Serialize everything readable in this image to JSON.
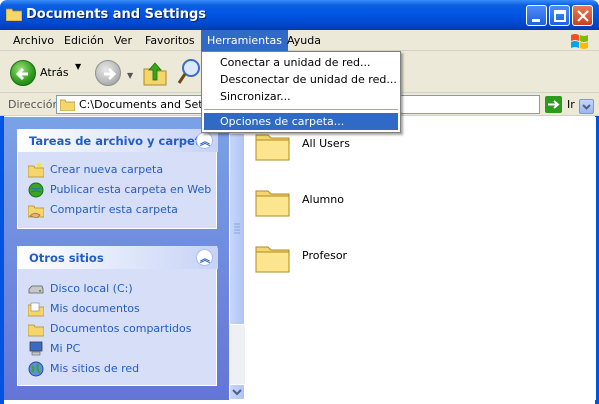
{
  "window": {
    "title": "Documents and Settings"
  },
  "menubar": {
    "items": [
      "Archivo",
      "Edición",
      "Ver",
      "Favoritos",
      "Herramientas",
      "Ayuda"
    ],
    "active": "Herramientas"
  },
  "toolbar": {
    "back_label": "Atrás"
  },
  "address": {
    "label": "Dirección",
    "value": "C:\\Documents and Settin",
    "go_label": "Ir"
  },
  "dropdown": {
    "items": [
      "Conectar a unidad de red...",
      "Desconectar de unidad de red...",
      "Sincronizar...",
      "Opciones de carpeta..."
    ],
    "selected": "Opciones de carpeta..."
  },
  "tasks_panel": {
    "title": "Tareas de archivo y carpeta",
    "items": [
      {
        "label": "Crear nueva carpeta",
        "icon": "new-folder-icon"
      },
      {
        "label": "Publicar esta carpeta en Web",
        "icon": "web-publish-icon"
      },
      {
        "label": "Compartir esta carpeta",
        "icon": "share-folder-icon"
      }
    ]
  },
  "other_places": {
    "title": "Otros sitios",
    "items": [
      {
        "label": "Disco local (C:)",
        "icon": "drive-icon"
      },
      {
        "label": "Mis documentos",
        "icon": "documents-folder-icon"
      },
      {
        "label": "Documentos compartidos",
        "icon": "shared-documents-icon"
      },
      {
        "label": "Mi PC",
        "icon": "computer-icon"
      },
      {
        "label": "Mis sitios de red",
        "icon": "network-icon"
      }
    ]
  },
  "files": [
    {
      "name": "All Users"
    },
    {
      "name": "Alumno"
    },
    {
      "name": "Profesor"
    }
  ],
  "colors": {
    "titlebar": "#0054e3",
    "menu_highlight": "#316ac5",
    "task_link": "#215dc6",
    "panel_bg": "#d6dff7",
    "pane_bg": "#7ba2e7"
  }
}
